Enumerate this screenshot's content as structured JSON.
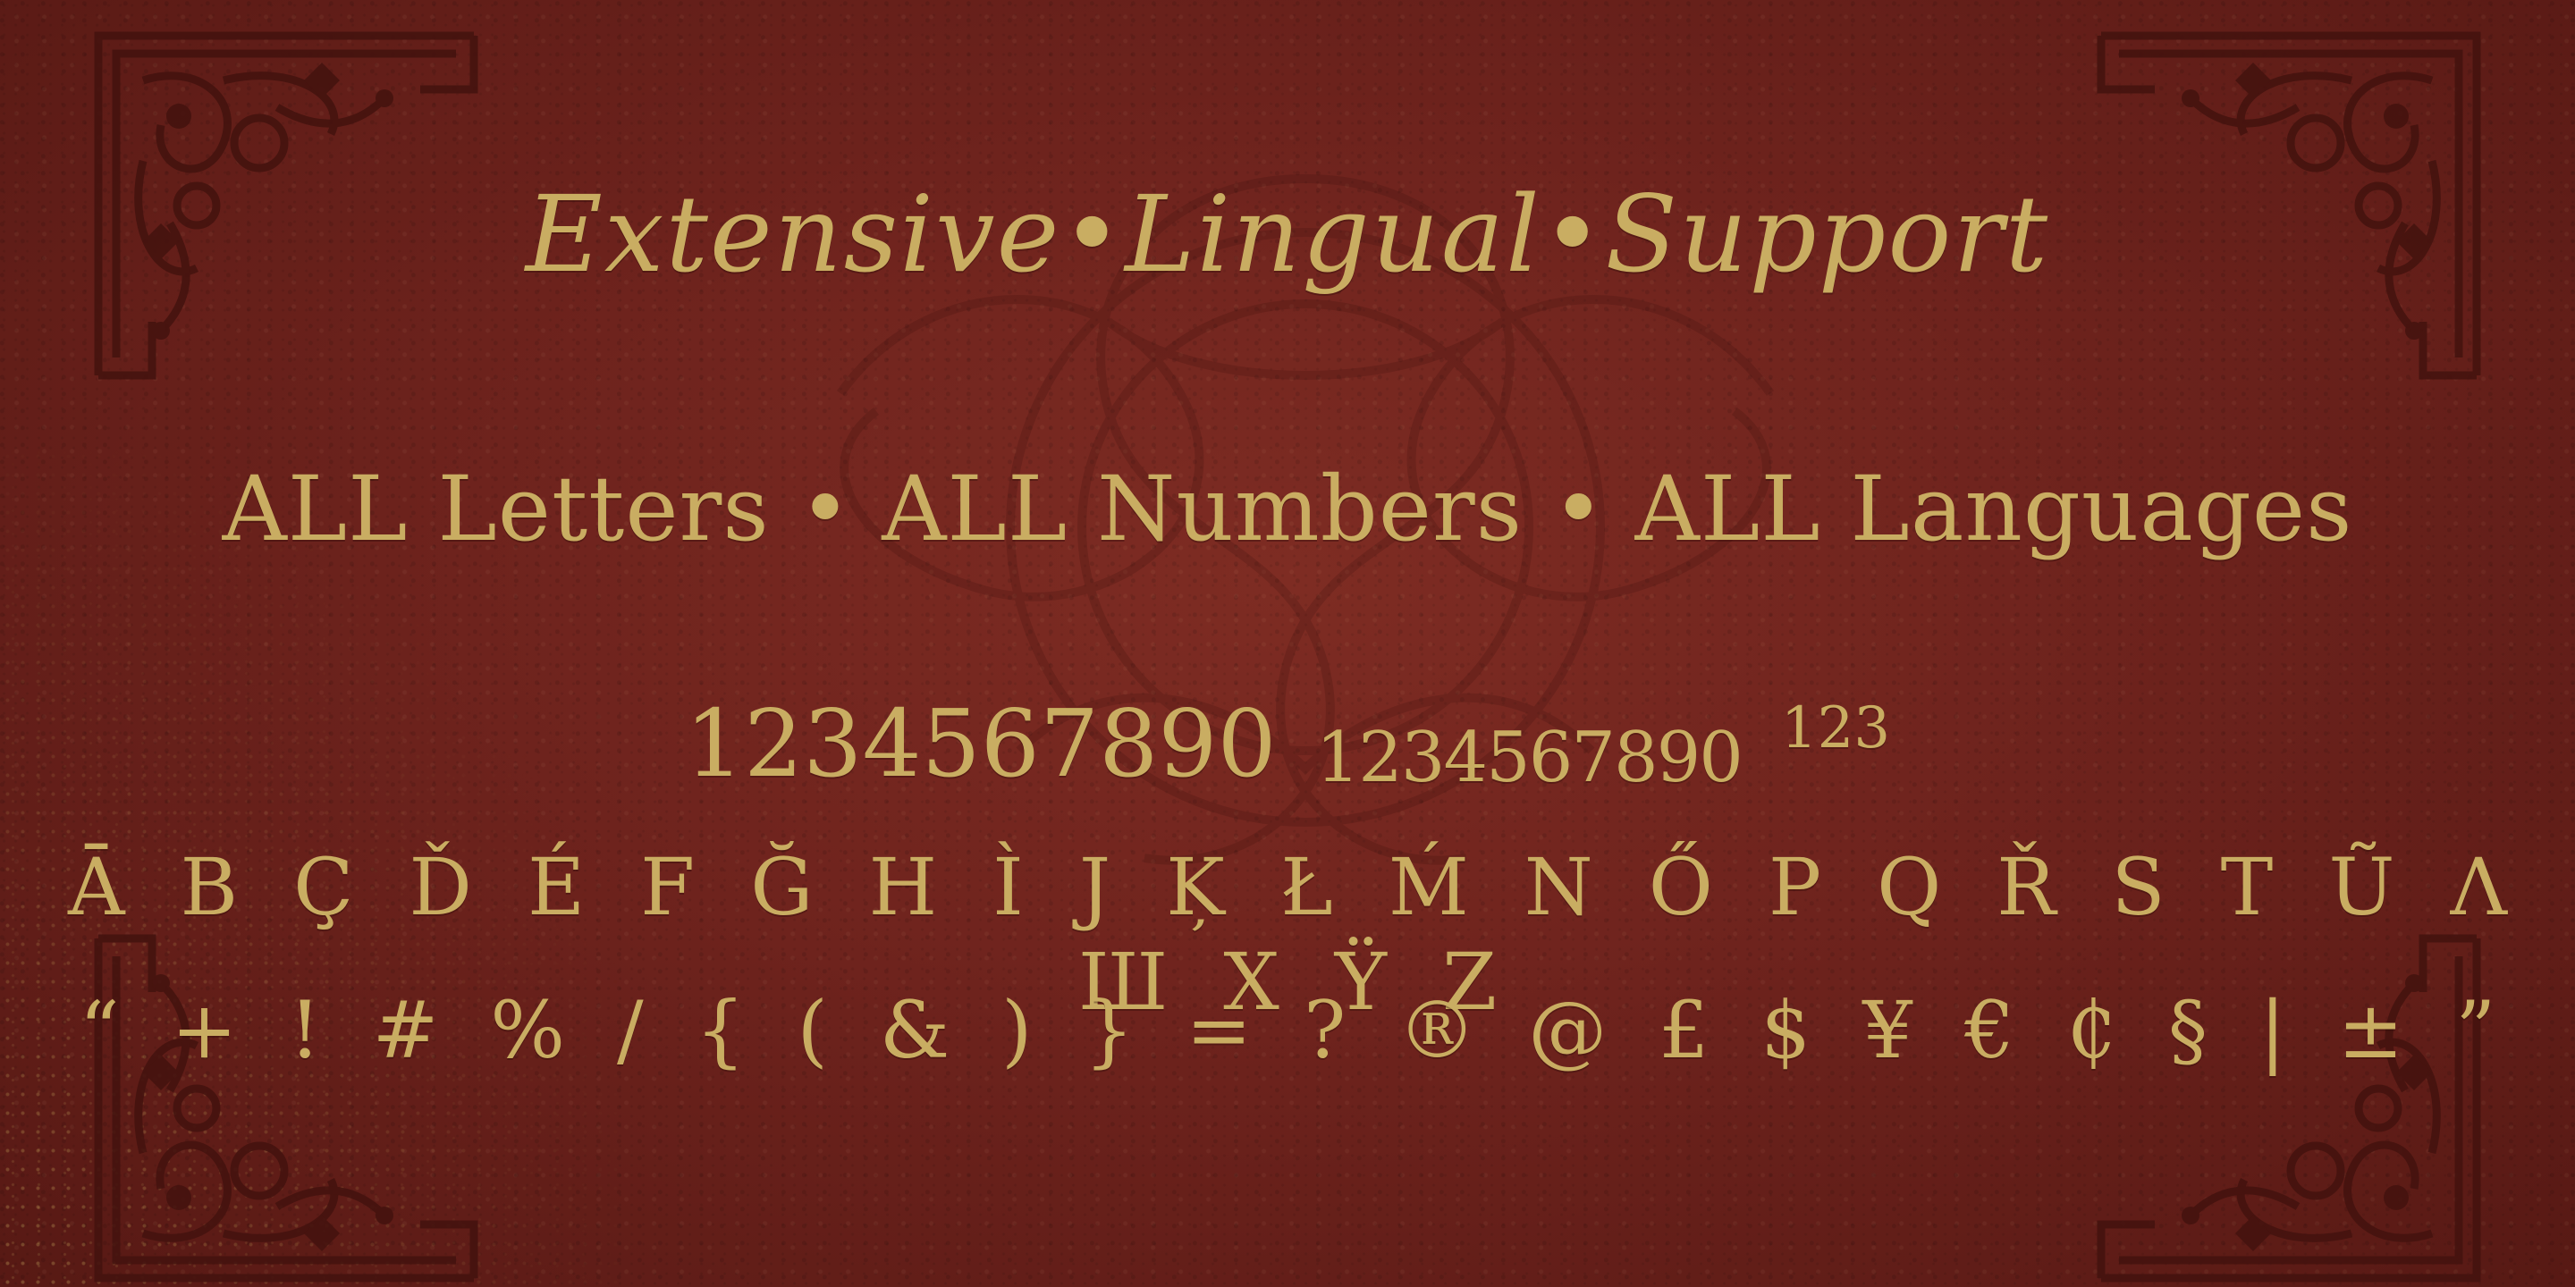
{
  "headline": "Extensive•Lingual•Support",
  "subline": "ALL Letters • ALL Numbers • ALL Languages",
  "numbers": {
    "lining": "1234567890",
    "oldstyle": "1234567890",
    "superscript": "123"
  },
  "alphabet": "Ā B Ç Ď É F Ğ H Ì J Ķ Ł Ḿ N Ő P Q Ř S T Ũ Λ Ш X Ÿ Z",
  "symbols": "“ + ! # % / { ( & ) } = ? ® @ £ $ ¥ € ₵ § | ± ”",
  "colors": {
    "background": "#6e231d",
    "gold": "#c9ad62",
    "ornament": "#4a1512"
  },
  "icons": [
    "corner-ornament-icon",
    "celtic-knot-icon"
  ]
}
